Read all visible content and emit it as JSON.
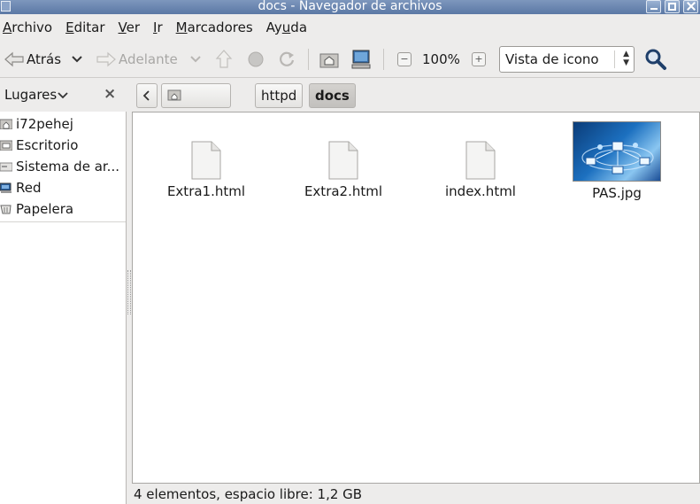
{
  "window": {
    "title": "docs - Navegador de archivos"
  },
  "menubar": [
    {
      "mnemonic": "A",
      "rest": "rchivo"
    },
    {
      "mnemonic": "E",
      "rest": "ditar"
    },
    {
      "mnemonic": "V",
      "rest": "er"
    },
    {
      "mnemonic": "I",
      "rest": "r"
    },
    {
      "mnemonic": "M",
      "rest": "arcadores"
    },
    {
      "pre": "Ay",
      "mnemonic": "u",
      "rest": "da"
    }
  ],
  "toolbar": {
    "back_label": "Atrás",
    "forward_label": "Adelante",
    "zoom_level": "100%",
    "view_mode": "Vista de icono"
  },
  "sidebar": {
    "header": "Lugares",
    "places": [
      {
        "label": "i72pehej",
        "icon": "home-folder-icon"
      },
      {
        "label": "Escritorio",
        "icon": "desktop-icon"
      },
      {
        "label": "Sistema de ar...",
        "icon": "filesystem-icon"
      },
      {
        "label": "Red",
        "icon": "network-icon"
      },
      {
        "label": "Papelera",
        "icon": "trash-icon"
      }
    ]
  },
  "pathbar": {
    "crumbs": [
      "i72pehej",
      "httpd",
      "docs"
    ],
    "active": "docs"
  },
  "files": [
    {
      "name": "Extra1.html",
      "type": "html"
    },
    {
      "name": "Extra2.html",
      "type": "html"
    },
    {
      "name": "index.html",
      "type": "html"
    },
    {
      "name": "PAS.jpg",
      "type": "image"
    }
  ],
  "status": {
    "text": "4 elementos, espacio libre: 1,2 GB"
  },
  "colors": {
    "titlebar": "#6a86b0",
    "content_bg": "#ffffff",
    "window_bg": "#edeceb"
  }
}
